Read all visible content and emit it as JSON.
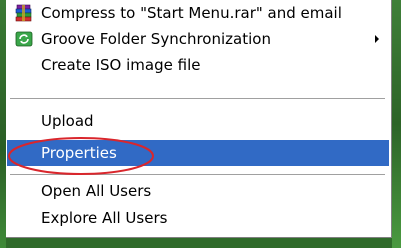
{
  "context_menu": {
    "items": [
      {
        "label": "Compress to \"Start Menu.rar\" and email",
        "icon": "winrar-books-icon"
      },
      {
        "label": "Groove Folder Synchronization",
        "icon": "groove-sync-icon",
        "submenu": true
      },
      {
        "label": "Create ISO image file"
      },
      {
        "label": "Upload"
      },
      {
        "label": "Properties",
        "selected": true
      },
      {
        "label": "Open All Users"
      },
      {
        "label": "Explore All Users"
      }
    ]
  },
  "colors": {
    "selection": "#316ac5",
    "annotation_ellipse": "#d9262c",
    "desktop": "#2f6b2a"
  }
}
